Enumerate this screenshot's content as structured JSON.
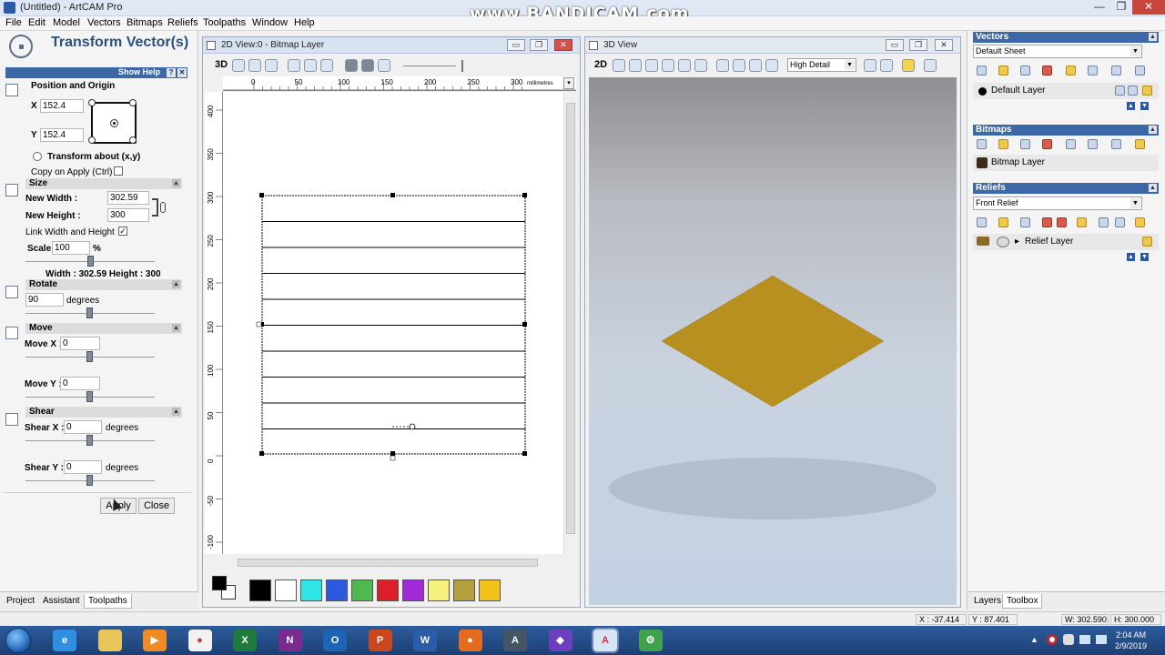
{
  "window": {
    "title": "(Untitled) - ArtCAM Pro",
    "watermark": "www.BANDICAM.com",
    "controls": [
      "—",
      "❐",
      "✕"
    ]
  },
  "menu": [
    "File",
    "Edit",
    "Model",
    "Vectors",
    "Bitmaps",
    "Reliefs",
    "Toolpaths",
    "Window",
    "Help"
  ],
  "assistant": {
    "title": "Transform Vector(s)",
    "show_help": "Show Help",
    "help_q": "?",
    "help_x": "✕",
    "position_origin": "Position and Origin",
    "x_label": "X :",
    "x_value": "152.4",
    "y_label": "Y :",
    "y_value": "152.4",
    "transform_about": "Transform about (x,y)",
    "copy_on_apply": "Copy on Apply (Ctrl)",
    "size": {
      "header": "Size",
      "new_width_label": "New Width :",
      "new_width": "302.59",
      "new_height_label": "New Height :",
      "new_height": "300",
      "link": "Link Width and Height",
      "scale_label": "Scale",
      "scale": "100",
      "scale_unit": "%",
      "summary": "Width : 302.59  Height : 300"
    },
    "rotate": {
      "header": "Rotate",
      "value": "90",
      "unit": "degrees"
    },
    "move": {
      "header": "Move",
      "x_label": "Move X :",
      "x": "0",
      "y_label": "Move Y :",
      "y": "0"
    },
    "shear": {
      "header": "Shear",
      "x_label": "Shear X :",
      "x": "0",
      "y_label": "Shear Y :",
      "y": "0",
      "unit": "degrees"
    },
    "apply": "Apply",
    "close": "Close",
    "tabs": [
      "Project",
      "Assistant",
      "Toolpaths"
    ]
  },
  "view2d": {
    "title": "2D View:0 - Bitmap Layer",
    "mode": "3D",
    "units": "millimetres",
    "ruler_top": [
      "0",
      "50",
      "100",
      "150",
      "200",
      "250",
      "300"
    ],
    "ruler_left": [
      "400",
      "350",
      "300",
      "250",
      "200",
      "150",
      "100",
      "50",
      "0",
      "-50",
      "-100"
    ],
    "palette": [
      "#000000",
      "#ffffff",
      "#2ee6e6",
      "#2d59e0",
      "#4fb84f",
      "#dd1f2a",
      "#a229d9",
      "#f6f27d",
      "#b3a03c",
      "#f0c21a"
    ]
  },
  "view3d": {
    "title": "3D View",
    "mode": "2D",
    "detail": "High Detail",
    "relief_color": "#b8901f"
  },
  "right": {
    "vectors": {
      "header": "Vectors",
      "sheet": "Default Sheet",
      "layer": "Default Layer"
    },
    "bitmaps": {
      "header": "Bitmaps",
      "layer": "Bitmap Layer"
    },
    "reliefs": {
      "header": "Reliefs",
      "selected": "Front Relief",
      "layer": "Relief Layer"
    },
    "tabs": [
      "Layers",
      "Toolbox"
    ]
  },
  "status": {
    "x": "X : -37.414",
    "y": "Y : 87.401",
    "w": "W: 302.590",
    "h": "H: 300.000"
  },
  "taskbar": {
    "apps": [
      "IE",
      "Folder",
      "Media",
      "Chrome",
      "Excel",
      "OneNote",
      "Outlook",
      "PowerPoint",
      "Word",
      "Firefox",
      "ArtCAM",
      "VisualStudio",
      "ArtCAM Pro",
      "Settings"
    ],
    "time": "2:04 AM",
    "date": "2/9/2019"
  }
}
